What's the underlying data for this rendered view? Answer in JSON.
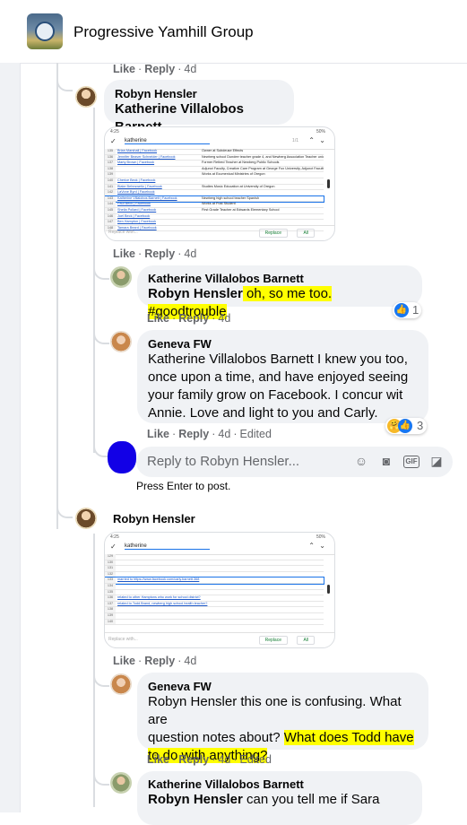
{
  "header": {
    "group_name": "Progressive Yamhill Group"
  },
  "actions": {
    "like": "Like",
    "reply": "Reply",
    "sep": "·",
    "edited": "Edited"
  },
  "top_action_time": "4d",
  "comments": [
    {
      "author": "Robyn Hensler",
      "tag": "Katherine Villalobos Barnett",
      "time": "4d",
      "screenshot": {
        "status_left": "4:25",
        "status_right": "50%",
        "search_query": "katherine",
        "search_count": "1/1",
        "rows": [
          {
            "n": "135",
            "a": "Brian Marshall | Facebook",
            "b": "Owner at Subdeuse Effects"
          },
          {
            "n": "136",
            "a": "Jennifer Beaver Schneider | Facebook",
            "b": "Newberg school Dundee teacher grade 4, and Newberg Association Teacher union"
          },
          {
            "n": "137",
            "a": "Marty Brown | Facebook",
            "b": "Former Retired Teacher at Newberg Public Schools"
          },
          {
            "n": "138",
            "a": "",
            "b": "Adjunct Faculty, Creative Care Program at George Fox University, Adjunct Faculty"
          },
          {
            "n": "139",
            "a": "",
            "b": "Works at Ecumenical Ministries of Oregon"
          },
          {
            "n": "140",
            "a": "Cherice Beck | Facebook",
            "b": ""
          },
          {
            "n": "141",
            "a": "Blake Behnsweitz | Facebook",
            "b": "Studies Music Education at University of Oregon"
          },
          {
            "n": "142",
            "a": "LaVone Byrd | Facebook",
            "b": ""
          },
          {
            "n": "143",
            "a": "Katherine Villalobos Barnett | Facebook",
            "b": "Newberg high school teacher Spanish"
          },
          {
            "n": "144",
            "a": "Paul Beck | Facebook",
            "b": "Works at Post Student"
          },
          {
            "n": "145",
            "a": "Sheila Pollard | Facebook",
            "b": "First Grade Teacher at Edwards Elementary School"
          },
          {
            "n": "146",
            "a": "Joel Beck | Facebook",
            "b": ""
          },
          {
            "n": "147",
            "a": "Ben Hampton | Facebook",
            "b": ""
          },
          {
            "n": "148",
            "a": "Tamara Beard | Facebook",
            "b": ""
          }
        ],
        "replace_placeholder": "Replace with...",
        "replace_btn": "Replace",
        "all_btn": "All"
      }
    },
    {
      "author": "Katherine Villalobos Barnett",
      "tag": "Robyn Hensler",
      "text": " oh, so me too. #goodtrouble",
      "time": "4d",
      "reaction_count": "1"
    },
    {
      "author": "Geneva FW",
      "text_lines": [
        "Katherine Villalobos Barnett I knew you too,",
        "once upon a time, and have enjoyed seeing",
        "your family grow on Facebook. I concur wit",
        "Annie. Love and light to you and Carly."
      ],
      "time": "4d",
      "reaction_count": "3"
    },
    {
      "author": "Robyn Hensler",
      "time": "4d",
      "screenshot": {
        "status_left": "4:25",
        "status_right": "50%",
        "search_query": "katherine",
        "rows": [
          {
            "n": "129",
            "a": "",
            "b": ""
          },
          {
            "n": "130",
            "a": "",
            "b": ""
          },
          {
            "n": "131",
            "a": "",
            "b": ""
          },
          {
            "n": "132",
            "a": "",
            "b": ""
          },
          {
            "n": "133",
            "a": "married to https://www.facebook.com/carly.barnett.368",
            "b": ""
          },
          {
            "n": "134",
            "a": "",
            "b": ""
          },
          {
            "n": "135",
            "a": "",
            "b": ""
          },
          {
            "n": "136",
            "a": "related to other Hamptons who work for school district?",
            "b": ""
          },
          {
            "n": "137",
            "a": "related to Todd Brand, newberg high school health teacher?",
            "b": ""
          },
          {
            "n": "138",
            "a": "",
            "b": ""
          },
          {
            "n": "139",
            "a": "",
            "b": ""
          },
          {
            "n": "140",
            "a": "",
            "b": ""
          }
        ],
        "replace_placeholder": "Replace with...",
        "replace_btn": "Replace",
        "all_btn": "All"
      }
    },
    {
      "author": "Geneva FW",
      "text_lines": [
        "Robyn Hensler this one is confusing. What are",
        "question notes about? ",
        "What does Todd have",
        "to do with anything?"
      ],
      "time": "4d"
    },
    {
      "author": "Katherine Villalobos Barnett",
      "tag": "Robyn Hensler",
      "text": " can you tell me if Sara"
    }
  ],
  "reply_box": {
    "placeholder": "Reply to Robyn Hensler...",
    "hint": "Press Enter to post."
  },
  "colors": {
    "highlight": "#ffff00",
    "like_blue": "#1877f2",
    "self_avatar": "#1200e6"
  }
}
